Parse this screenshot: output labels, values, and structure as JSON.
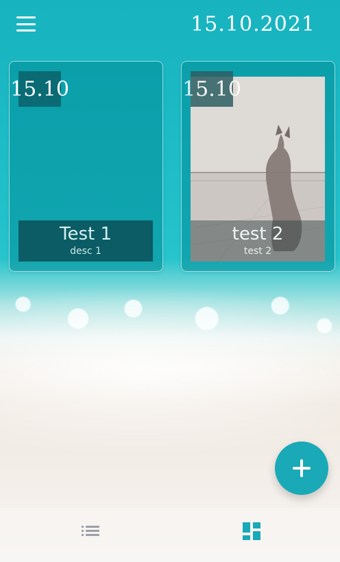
{
  "header": {
    "date": "15.10.2021",
    "menu_icon": "menu-icon"
  },
  "cards": [
    {
      "chip": "15.10",
      "title": "Test 1",
      "desc": "desc 1",
      "has_photo": false
    },
    {
      "chip": "15.10",
      "title": "test 2",
      "desc": "test 2",
      "has_photo": true
    }
  ],
  "fab": {
    "icon": "plus-icon",
    "color": "#1aa9b7"
  },
  "bottom_nav": {
    "items": [
      {
        "name": "list-view",
        "icon": "list-icon",
        "active": false
      },
      {
        "name": "grid-view",
        "icon": "grid-icon",
        "active": true
      }
    ],
    "active_color": "#1aa9b7",
    "inactive_color": "#9aa0a6"
  }
}
